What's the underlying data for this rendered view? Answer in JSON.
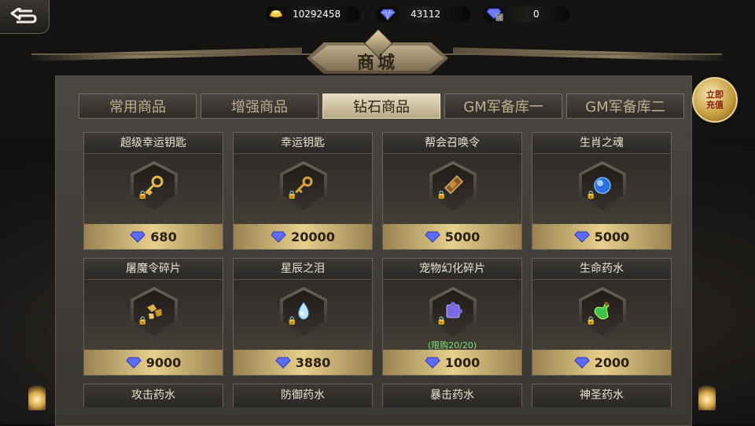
{
  "currencies": [
    {
      "icon": "gold-ingot-icon",
      "value": "10292458"
    },
    {
      "icon": "diamond-icon",
      "value": "43112"
    },
    {
      "icon": "bound-diamond-icon",
      "value": "0"
    }
  ],
  "title": "商城",
  "recharge": {
    "line1": "立即",
    "line2": "充值"
  },
  "tabs": [
    {
      "label": "常用商品",
      "active": false
    },
    {
      "label": "增强商品",
      "active": false
    },
    {
      "label": "钻石商品",
      "active": true
    },
    {
      "label": "GM军备库一",
      "active": false
    },
    {
      "label": "GM军备库二",
      "active": false
    }
  ],
  "items": [
    {
      "name": "超级幸运钥匙",
      "price": "680",
      "icon": "golden-key-icon"
    },
    {
      "name": "幸运钥匙",
      "price": "20000",
      "icon": "key-icon"
    },
    {
      "name": "帮会召唤令",
      "price": "5000",
      "icon": "token-icon"
    },
    {
      "name": "生肖之魂",
      "price": "5000",
      "icon": "blue-orb-icon"
    },
    {
      "name": "屠魔令碎片",
      "price": "9000",
      "icon": "fragment-icon"
    },
    {
      "name": "星辰之泪",
      "price": "3880",
      "icon": "teardrop-icon"
    },
    {
      "name": "宠物幻化碎片",
      "price": "1000",
      "icon": "puzzle-icon",
      "limit": "(限购20/20)"
    },
    {
      "name": "生命药水",
      "price": "2000",
      "icon": "green-potion-icon"
    }
  ],
  "bottom_items": [
    "攻击药水",
    "防御药水",
    "暴击药水",
    "神圣药水"
  ],
  "colors": {
    "accent_gold": "#e7cf8d",
    "diamond": "#5b6cff",
    "limit_green": "#7fe07a"
  }
}
